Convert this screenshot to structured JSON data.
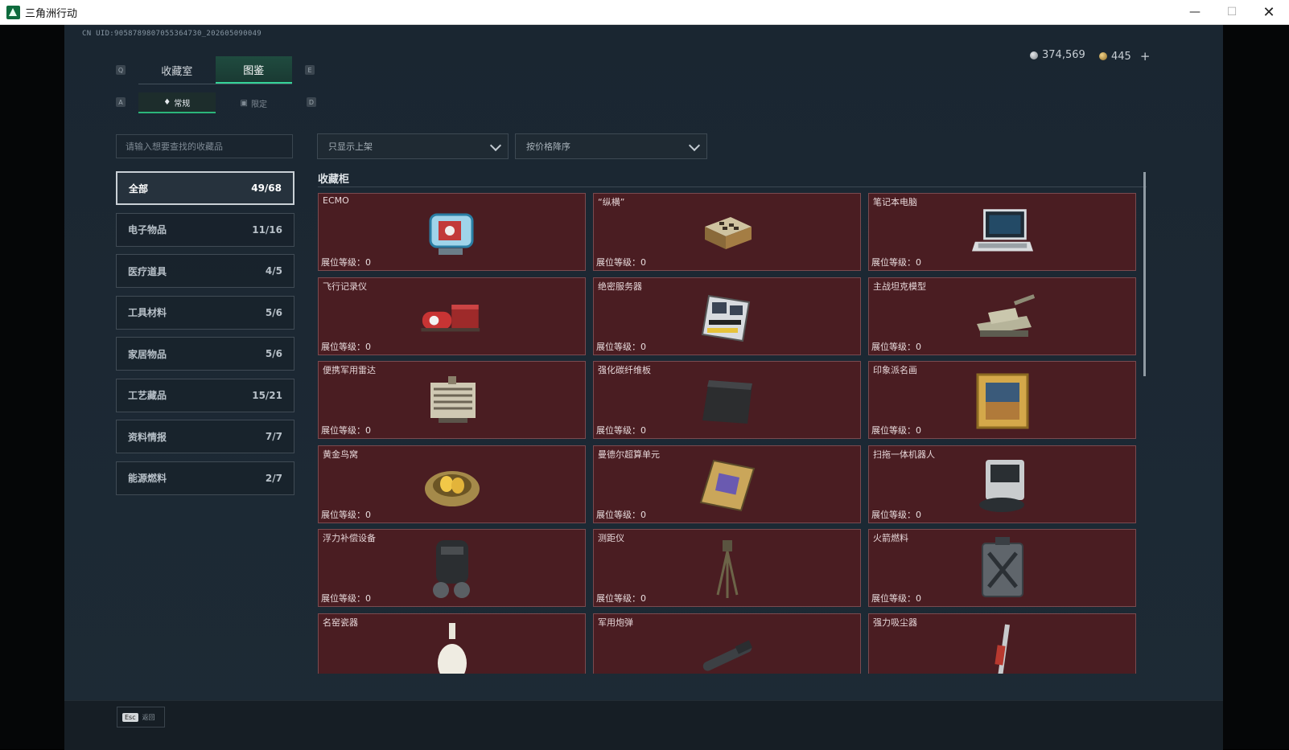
{
  "window": {
    "title": "三角洲行动",
    "min": "—",
    "max": "☐",
    "close": "✕"
  },
  "header": {
    "uid": "CN UID:9058789807055364730_202605090049",
    "silver": "374,569",
    "gold": "445",
    "plus": "+"
  },
  "keys": {
    "q": "Q",
    "e": "E",
    "a": "A",
    "d": "D"
  },
  "tabs": [
    {
      "label": "收藏室"
    },
    {
      "label": "图鉴"
    }
  ],
  "subtabs": [
    {
      "label": "常规",
      "icon": "flame-icon"
    },
    {
      "label": "限定",
      "icon": "image-icon"
    }
  ],
  "search": {
    "placeholder": "请输入想要查找的收藏品"
  },
  "categories": [
    {
      "label": "全部",
      "count": "49/68"
    },
    {
      "label": "电子物品",
      "count": "11/16"
    },
    {
      "label": "医疗道具",
      "count": "4/5"
    },
    {
      "label": "工具材料",
      "count": "5/6"
    },
    {
      "label": "家居物品",
      "count": "5/6"
    },
    {
      "label": "工艺藏品",
      "count": "15/21"
    },
    {
      "label": "资料情报",
      "count": "7/7"
    },
    {
      "label": "能源燃料",
      "count": "2/7"
    }
  ],
  "filters": {
    "listing": "只显示上架",
    "sort": "按价格降序"
  },
  "section": {
    "title": "收藏柜"
  },
  "level_label": "展位等级：0",
  "items": [
    {
      "name": "ECMO",
      "icon": "ecmo-machine-icon"
    },
    {
      "name": "“纵横”",
      "icon": "chess-box-icon"
    },
    {
      "name": "笔记本电脑",
      "icon": "laptop-icon"
    },
    {
      "name": "飞行记录仪",
      "icon": "flight-recorder-icon"
    },
    {
      "name": "绝密服务器",
      "icon": "server-icon"
    },
    {
      "name": "主战坦克模型",
      "icon": "tank-model-icon"
    },
    {
      "name": "便携军用雷达",
      "icon": "radar-icon"
    },
    {
      "name": "强化碳纤维板",
      "icon": "carbon-plate-icon"
    },
    {
      "name": "印象派名画",
      "icon": "painting-icon"
    },
    {
      "name": "黄金鸟窝",
      "icon": "golden-nest-icon"
    },
    {
      "name": "曼德尔超算单元",
      "icon": "compute-unit-icon"
    },
    {
      "name": "扫拖一体机器人",
      "icon": "robot-vacuum-icon"
    },
    {
      "name": "浮力补偿设备",
      "icon": "bcd-vest-icon"
    },
    {
      "name": "测距仪",
      "icon": "rangefinder-icon"
    },
    {
      "name": "火箭燃料",
      "icon": "fuel-can-icon"
    },
    {
      "name": "名窑瓷器",
      "icon": "porcelain-vase-icon"
    },
    {
      "name": "军用炮弹",
      "icon": "artillery-shell-icon"
    },
    {
      "name": "强力吸尘器",
      "icon": "vacuum-cleaner-icon"
    }
  ],
  "footer": {
    "esc_key": "Esc",
    "back": "返回"
  },
  "colors": {
    "accent": "#34d399",
    "card_bg": "#4a1d22",
    "card_border": "#7a4a4f"
  }
}
